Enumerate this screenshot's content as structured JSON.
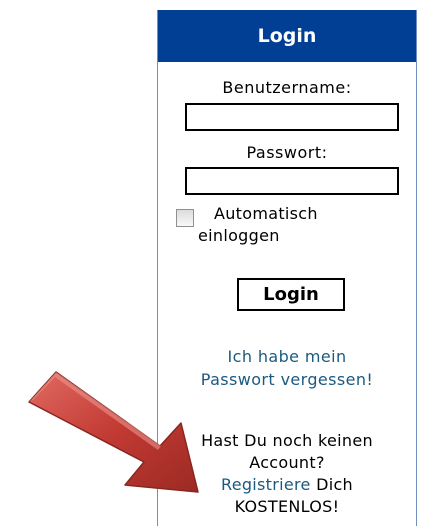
{
  "login": {
    "title": "Login",
    "username_label": "Benutzername:",
    "username_value": "",
    "password_label": "Passwort:",
    "password_value": "",
    "auto_login_checked": false,
    "auto_login_line1": "Automatisch",
    "auto_login_line2": "einloggen",
    "login_button": "Login",
    "forgot_line1": "Ich habe mein",
    "forgot_line2": "Passwort vergessen!",
    "register_line1": "Hast Du noch keinen",
    "register_line2": "Account?",
    "register_link": "Registriere",
    "register_line3_rest": " Dich",
    "register_line4": "KOSTENLOS!"
  },
  "colors": {
    "header_bg": "#003f93",
    "link": "#1a5a80",
    "arrow": "#c0403a"
  },
  "icons": {
    "annotation_arrow": "arrow-pointing-right-down"
  }
}
